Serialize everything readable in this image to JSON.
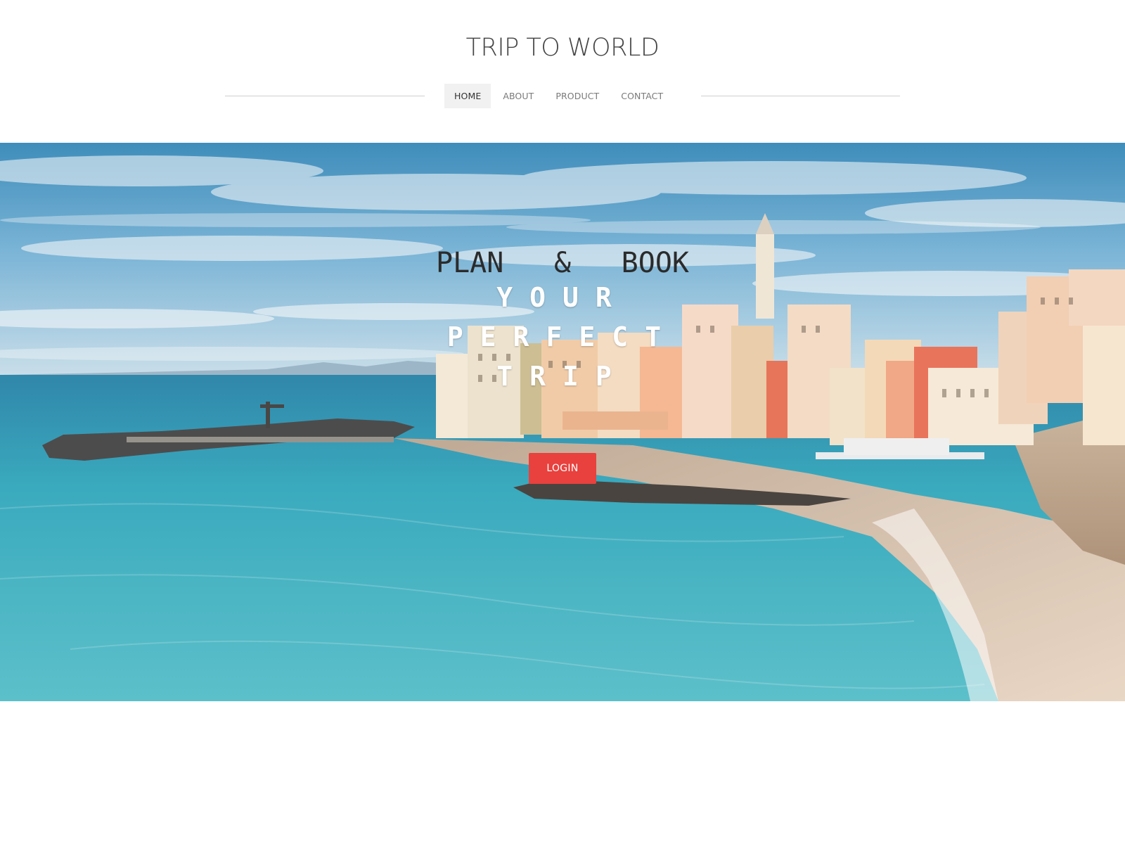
{
  "site": {
    "title": "TRIP TO WORLD"
  },
  "nav": {
    "items": [
      {
        "label": "HOME",
        "active": true
      },
      {
        "label": "ABOUT",
        "active": false
      },
      {
        "label": "PRODUCT",
        "active": false
      },
      {
        "label": "CONTACT",
        "active": false
      }
    ]
  },
  "hero": {
    "headline_words": [
      "PLAN",
      "&",
      "BOOK"
    ],
    "headline_line2": "YOUR PERFECT TRIP",
    "login_label": "LOGIN",
    "image_description_icon": "coastal-village-photo"
  },
  "colors": {
    "accent": "#e8413e",
    "title_text": "#444444",
    "nav_active_bg": "#f1f1f1"
  }
}
